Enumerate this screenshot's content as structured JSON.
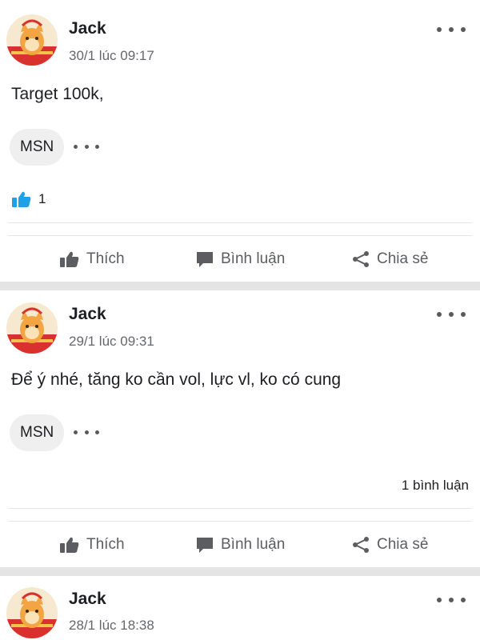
{
  "colors": {
    "like_blue": "#1fa1e8",
    "action_gray": "#5b5d61",
    "separator": "#e4e4e4"
  },
  "action_labels": {
    "like": "Thích",
    "comment": "Bình luận",
    "share": "Chia sẻ"
  },
  "posts": [
    {
      "author": "Jack",
      "timestamp": "30/1 lúc 09:17",
      "text": "Target 100k,",
      "tag": "MSN",
      "reactions": {
        "icon": "thumbs-up-icon",
        "count": "1"
      },
      "comments": ""
    },
    {
      "author": "Jack",
      "timestamp": "29/1 lúc 09:31",
      "text": "Để ý nhé, tăng ko cần vol, lực vl, ko có cung",
      "tag": "MSN",
      "reactions": {
        "icon": "",
        "count": ""
      },
      "comments": "1 bình luận"
    },
    {
      "author": "Jack",
      "timestamp": "28/1 lúc 18:38"
    }
  ]
}
